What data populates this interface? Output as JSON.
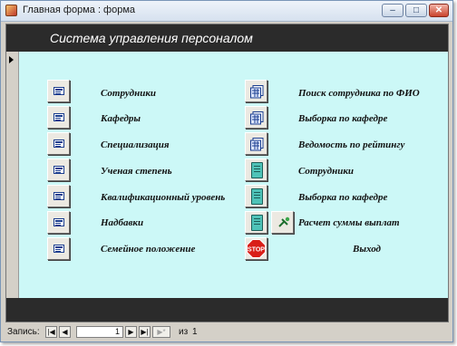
{
  "window": {
    "title": "Главная форма : форма"
  },
  "form": {
    "header_title": "Система управления персоналом"
  },
  "left_items": [
    {
      "label": "Сотрудники",
      "icon": "form-icon"
    },
    {
      "label": "Кафедры",
      "icon": "form-icon"
    },
    {
      "label": "Специализация",
      "icon": "form-icon"
    },
    {
      "label": "Ученая степень",
      "icon": "form-icon"
    },
    {
      "label": "Квалификационный уровень",
      "icon": "form-icon"
    },
    {
      "label": "Надбавки",
      "icon": "form-icon"
    },
    {
      "label": "Семейное положение",
      "icon": "form-icon"
    }
  ],
  "right_items": [
    {
      "label": "Поиск сотрудника по ФИО",
      "icon": "query-icon"
    },
    {
      "label": "Выборка по кафедре",
      "icon": "query-icon"
    },
    {
      "label": "Ведомость по рейтингу",
      "icon": "query-icon"
    },
    {
      "label": "Сотрудники",
      "icon": "report-icon"
    },
    {
      "label": "Выборка по кафедре",
      "icon": "report-icon"
    },
    {
      "label": "Расчет суммы выплат",
      "icon": "report-icon"
    },
    {
      "label": "Выход",
      "icon": "stop-icon"
    }
  ],
  "navigation": {
    "record_label": "Запись:",
    "current_record": "1",
    "of_label": "из",
    "total_records": "1"
  },
  "colors": {
    "form_background": "#ccf8f7",
    "header_band": "#2b2b2b",
    "stop_red": "#d91e18"
  }
}
